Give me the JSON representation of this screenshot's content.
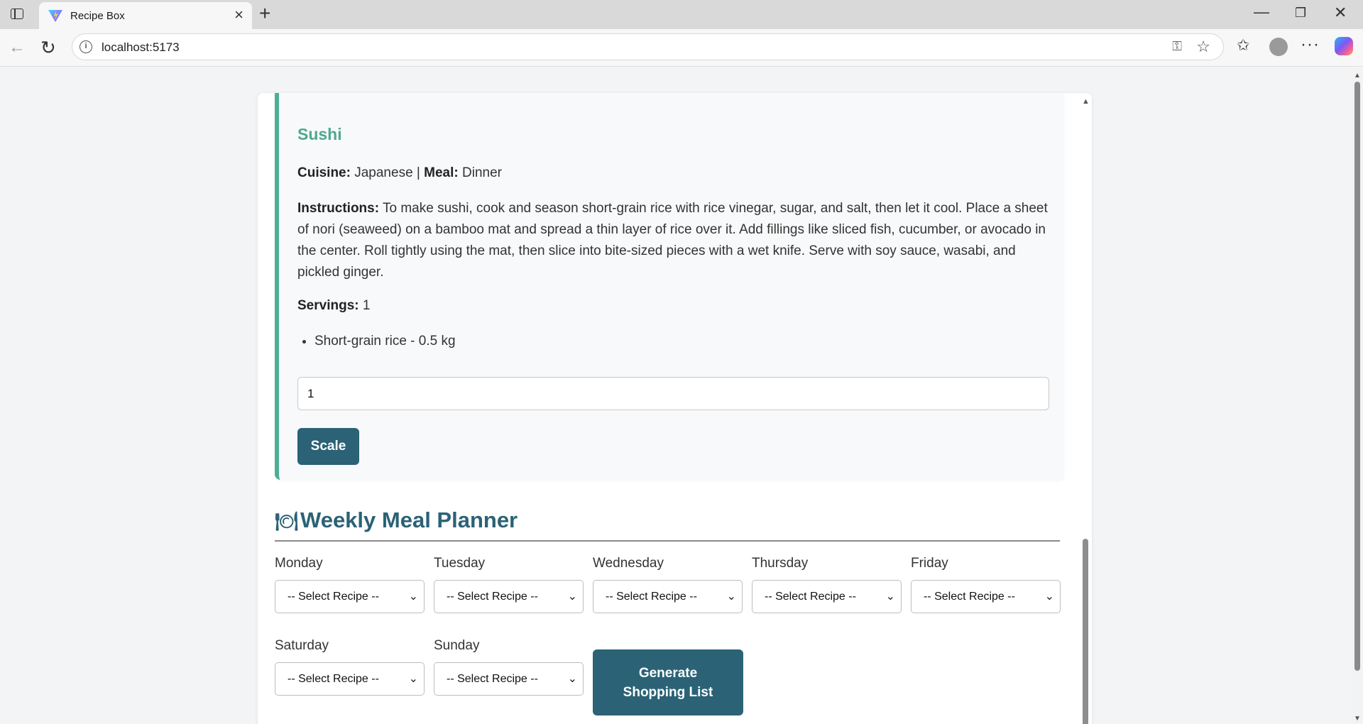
{
  "browser": {
    "tab_title": "Recipe Box",
    "url": "localhost:5173"
  },
  "recipe": {
    "name": "Sushi",
    "cuisine_label": "Cuisine:",
    "cuisine": "Japanese",
    "separator": "|",
    "meal_label": "Meal:",
    "meal": "Dinner",
    "instructions_label": "Instructions:",
    "instructions": "To make sushi, cook and season short-grain rice with rice vinegar, sugar, and salt, then let it cool. Place a sheet of nori (seaweed) on a bamboo mat and spread a thin layer of rice over it. Add fillings like sliced fish, cucumber, or avocado in the center. Roll tightly using the mat, then slice into bite-sized pieces with a wet knife. Serve with soy sauce, wasabi, and pickled ginger.",
    "servings_label": "Servings:",
    "servings": "1",
    "ingredients": [
      "Short-grain rice - 0.5 kg"
    ],
    "scale_value": "1",
    "scale_button": "Scale"
  },
  "planner": {
    "icon": "🍽",
    "title": "Weekly Meal Planner",
    "days": [
      {
        "label": "Monday",
        "selected": "-- Select Recipe --"
      },
      {
        "label": "Tuesday",
        "selected": "-- Select Recipe --"
      },
      {
        "label": "Wednesday",
        "selected": "-- Select Recipe --"
      },
      {
        "label": "Thursday",
        "selected": "-- Select Recipe --"
      },
      {
        "label": "Friday",
        "selected": "-- Select Recipe --"
      },
      {
        "label": "Saturday",
        "selected": "-- Select Recipe --"
      },
      {
        "label": "Sunday",
        "selected": "-- Select Recipe --"
      }
    ],
    "generate_button": "Generate Shopping List"
  },
  "icons": {
    "chevron": "⌄",
    "colors": {
      "accent": "#2b6275",
      "recipe_green": "#4ea88f"
    }
  }
}
